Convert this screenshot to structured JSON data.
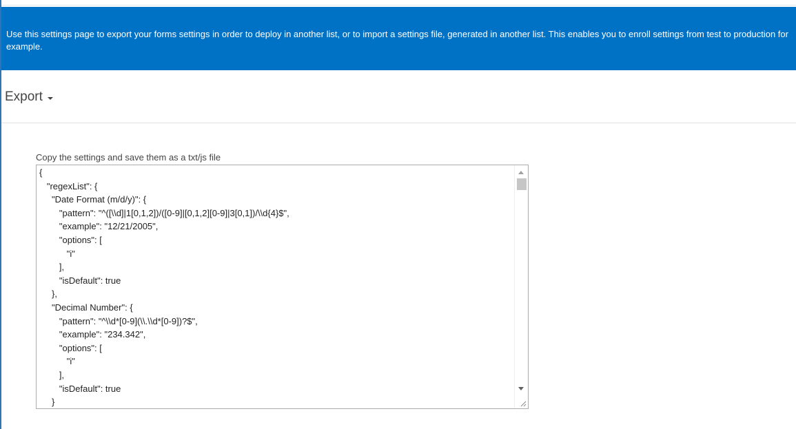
{
  "banner": {
    "text": "Use this settings page to export your forms settings in order to deploy in another list, or to import a settings file, generated in another list. This enables you to enroll settings from test to production for example."
  },
  "export": {
    "title": "Export"
  },
  "settings_field": {
    "label": "Copy the settings and save them as a txt/js file",
    "value": "{\n   \"regexList\": {\n     \"Date Format (m/d/y)\": {\n        \"pattern\": \"^([\\\\d]|1[0,1,2])/([0-9]|[0,1,2][0-9]|3[0,1])/\\\\d{4}$\",\n        \"example\": \"12/21/2005\",\n        \"options\": [\n           \"i\"\n        ],\n        \"isDefault\": true\n     },\n     \"Decimal Number\": {\n        \"pattern\": \"^\\\\d*[0-9](\\\\.\\\\d*[0-9])?$\",\n        \"example\": \"234.342\",\n        \"options\": [\n           \"i\"\n        ],\n        \"isDefault\": true\n     }"
  },
  "icons": {
    "dropdown": "caret-down-icon",
    "scroll_up": "scroll-up-arrow-icon",
    "scroll_down": "scroll-down-arrow-icon",
    "resize": "resize-grip-icon"
  },
  "colors": {
    "banner": "#0072c6",
    "accent_border": "#2e75b6"
  }
}
